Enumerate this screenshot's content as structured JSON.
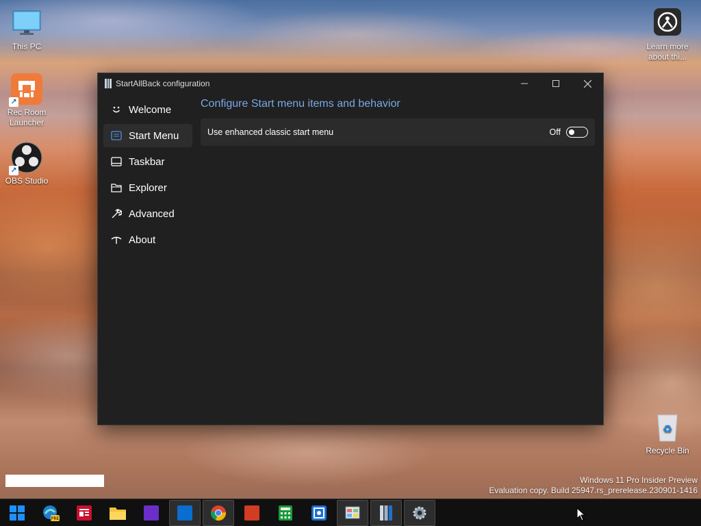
{
  "desktop": {
    "icons": [
      {
        "label": "This PC"
      },
      {
        "label": "Rec Room Launcher"
      },
      {
        "label": "OBS Studio"
      },
      {
        "label": "Learn more about thi..."
      },
      {
        "label": "Recycle Bin"
      }
    ],
    "watermark": {
      "line1": "Windows 11 Pro Insider Preview",
      "line2": "Evaluation copy. Build 25947.rs_prerelease.230901-1416"
    }
  },
  "window": {
    "title": "StartAllBack configuration",
    "nav": [
      {
        "label": "Welcome",
        "icon": "smiley-icon"
      },
      {
        "label": "Start Menu",
        "icon": "start-menu-icon",
        "active": true
      },
      {
        "label": "Taskbar",
        "icon": "taskbar-icon"
      },
      {
        "label": "Explorer",
        "icon": "folder-icon"
      },
      {
        "label": "Advanced",
        "icon": "wrench-icon"
      },
      {
        "label": "About",
        "icon": "info-icon"
      }
    ],
    "content": {
      "heading": "Configure Start menu items and behavior",
      "setting": {
        "label": "Use enhanced classic start menu",
        "state": "Off",
        "enabled": false
      }
    }
  },
  "taskbar": {
    "items": [
      {
        "icon": "windows-start-icon"
      },
      {
        "icon": "edge-preview-icon"
      },
      {
        "icon": "news-app-icon"
      },
      {
        "icon": "file-explorer-icon"
      },
      {
        "icon": "purple-app-icon"
      },
      {
        "icon": "blue-app-icon",
        "running": true
      },
      {
        "icon": "chrome-icon",
        "running": true
      },
      {
        "icon": "red-app-icon"
      },
      {
        "icon": "calculator-icon"
      },
      {
        "icon": "photo-app-icon"
      },
      {
        "icon": "control-panel-icon"
      },
      {
        "icon": "startallback-icon",
        "running": true
      },
      {
        "icon": "settings-icon",
        "running": true
      }
    ]
  },
  "colors": {
    "accent": "#7aa7e8",
    "window_bg": "#202020",
    "row_bg": "#2b2b2b",
    "taskbar_bg": "#101010"
  }
}
